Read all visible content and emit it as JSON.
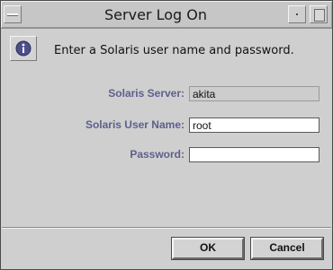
{
  "window": {
    "title": "Server Log On"
  },
  "message": "Enter a Solaris user name and password.",
  "form": {
    "server_label": "Solaris Server:",
    "server_value": "akita",
    "user_label": "Solaris User Name:",
    "user_value": "root",
    "password_label": "Password:",
    "password_value": ""
  },
  "buttons": {
    "ok": "OK",
    "cancel": "Cancel"
  },
  "icons": {
    "menu": "window-menu-icon",
    "minimize": "minimize-icon",
    "maximize": "maximize-icon",
    "info": "info-icon"
  },
  "colors": {
    "label": "#5e5f8d",
    "background": "#cfcfcf",
    "info_icon": "#4d4f8c"
  }
}
